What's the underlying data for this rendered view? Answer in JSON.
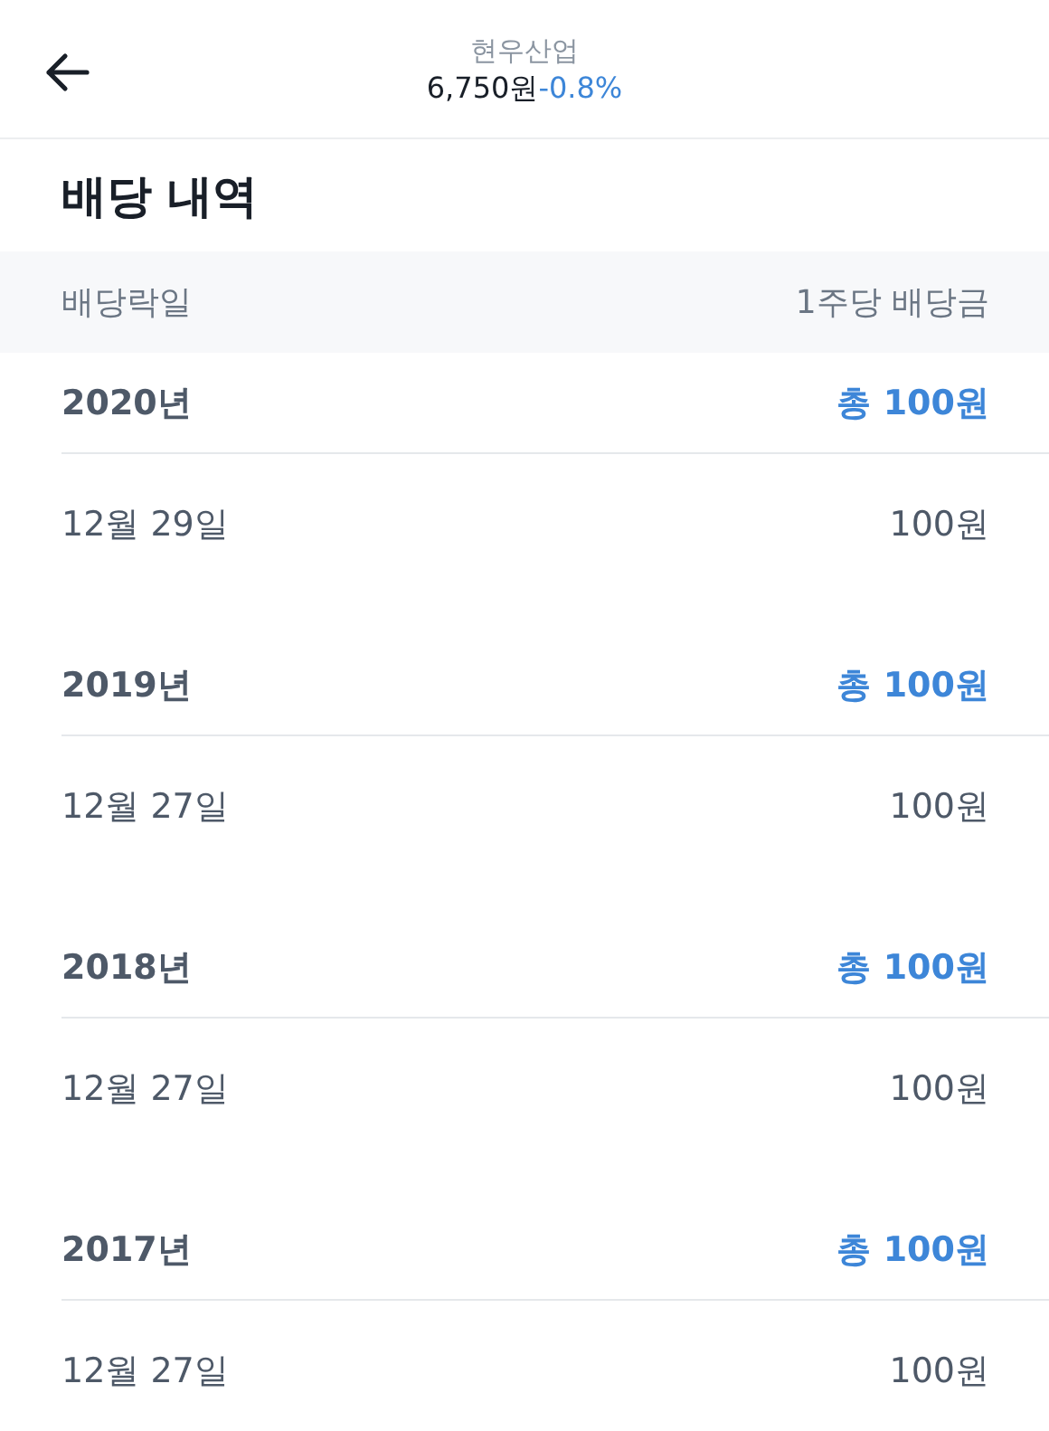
{
  "header": {
    "stock_name": "현우산업",
    "price": "6,750원",
    "change": "-0.8%"
  },
  "title": "배당 내역",
  "table": {
    "columns": [
      "배당락일",
      "1주당 배당금"
    ],
    "groups": [
      {
        "year": "2020년",
        "total": "총 100원",
        "rows": [
          {
            "date": "12월 29일",
            "amount": "100원"
          }
        ]
      },
      {
        "year": "2019년",
        "total": "총 100원",
        "rows": [
          {
            "date": "12월 27일",
            "amount": "100원"
          }
        ]
      },
      {
        "year": "2018년",
        "total": "총 100원",
        "rows": [
          {
            "date": "12월 27일",
            "amount": "100원"
          }
        ]
      },
      {
        "year": "2017년",
        "total": "총 100원",
        "rows": [
          {
            "date": "12월 27일",
            "amount": "100원"
          }
        ]
      }
    ]
  }
}
